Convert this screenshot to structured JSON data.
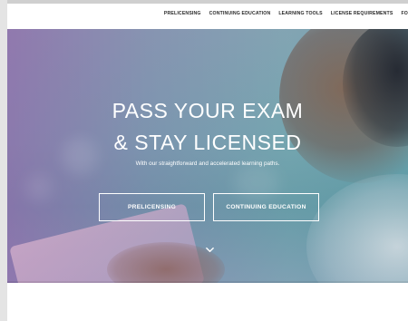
{
  "nav": {
    "items": [
      "PRELICENSING",
      "CONTINUING EDUCATION",
      "LEARNING TOOLS",
      "LICENSE REQUIREMENTS",
      "FO"
    ]
  },
  "hero": {
    "headline_line1": "PASS YOUR EXAM",
    "headline_line2": "& STAY LICENSED",
    "subtext": "With our straightforward and accelerated learning paths.",
    "buttons": {
      "prelicensing": "PRELICENSING",
      "continuing_education": "CONTINUING EDUCATION"
    },
    "scroll_icon": "chevron-down-icon"
  },
  "colors": {
    "nav_text": "#2b2b2b",
    "hero_text": "#ffffff",
    "overlay_purple": "#9260aa",
    "overlay_teal": "#3c96a0"
  }
}
